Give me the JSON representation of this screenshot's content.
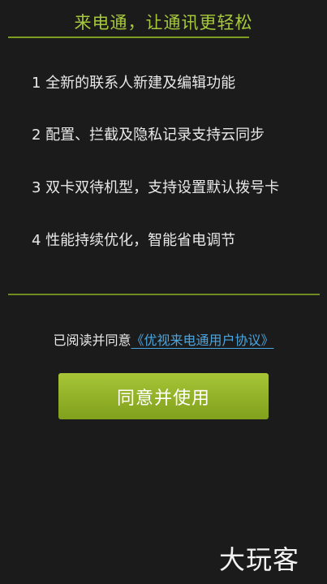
{
  "header": {
    "title": "来电通，让通讯更轻松"
  },
  "features": [
    "1 全新的联系人新建及编辑功能",
    "2 配置、拦截及隐私记录支持云同步",
    "3 双卡双待机型，支持设置默认拨号卡",
    "4 性能持续优化，智能省电调节"
  ],
  "agreement": {
    "prefix": "已阅读并同意",
    "link_text": "《优视来电通用户协议》"
  },
  "actions": {
    "agree_label": "同意并使用"
  },
  "watermark": {
    "text": "大玩客"
  },
  "colors": {
    "background": "#1b1b1b",
    "accent_green": "#a6c83a",
    "link_blue": "#4aa6e0",
    "button_green": "#94b22a"
  }
}
